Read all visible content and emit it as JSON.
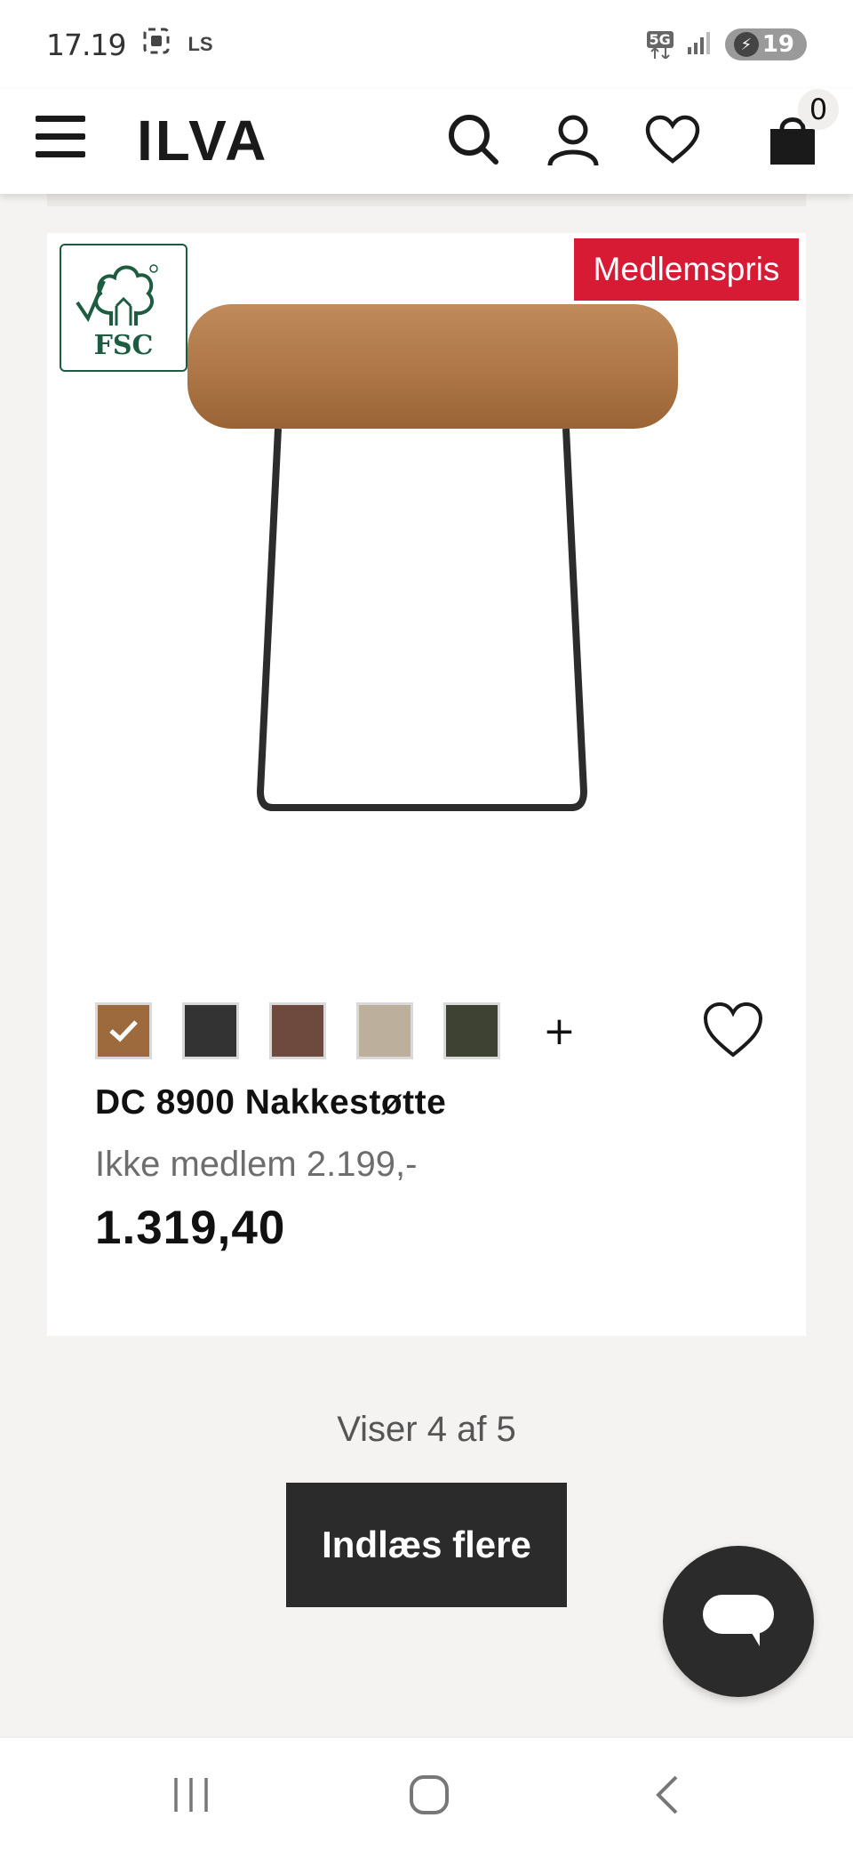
{
  "status_bar": {
    "time": "17.19",
    "carrier_label": "LS",
    "network_label": "5G",
    "battery_level": "19"
  },
  "header": {
    "logo_text": "ILVA",
    "cart_count": "0"
  },
  "product": {
    "badge_fsc": "FSC",
    "badge_member": "Medlemspris",
    "title": "DC 8900 Nakkestøtte",
    "old_price": "Ikke medlem 2.199,-",
    "price": "1.319,40",
    "swatches": [
      {
        "color": "#9c6a3c",
        "selected": true
      },
      {
        "color": "#333333",
        "selected": false
      },
      {
        "color": "#6e4a3e",
        "selected": false
      },
      {
        "color": "#bcb09d",
        "selected": false
      },
      {
        "color": "#3e4232",
        "selected": false
      }
    ],
    "more_colors_label": "+"
  },
  "pagination": {
    "status_text": "Viser 4 af 5",
    "load_more_label": "Indlæs flere"
  },
  "colors": {
    "member_badge": "#d81b35",
    "dark_button": "#2b2b2b",
    "fsc_green": "#1d5c40"
  }
}
